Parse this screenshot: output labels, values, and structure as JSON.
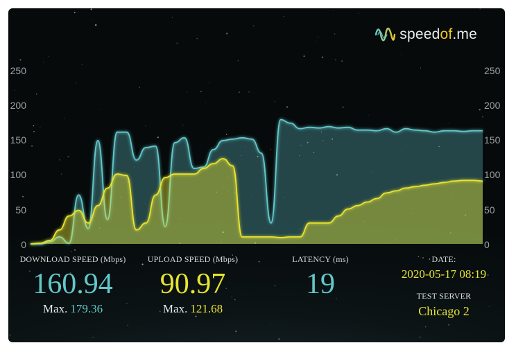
{
  "logo": {
    "text_pre": "speed",
    "text_of": "of",
    "text_post": ".me"
  },
  "colors": {
    "download": "#62c8cb",
    "upload": "#e8e432",
    "background": "#0b1315"
  },
  "axis": {
    "ticks": [
      "250",
      "200",
      "150",
      "100",
      "50",
      "0"
    ]
  },
  "download": {
    "label": "DOWNLOAD SPEED (Mbps)",
    "value": "160.94",
    "max_label": "Max.",
    "max_value": "179.36"
  },
  "upload": {
    "label": "UPLOAD SPEED (Mbps)",
    "value": "90.97",
    "max_label": "Max.",
    "max_value": "121.68"
  },
  "latency": {
    "label": "LATENCY (ms)",
    "value": "19"
  },
  "date": {
    "label": "DATE:",
    "value": "2020-05-17 08:19"
  },
  "server": {
    "label": "TEST SERVER",
    "value": "Chicago 2"
  },
  "chart_data": {
    "type": "area",
    "ylim": [
      0,
      250
    ],
    "grid": false,
    "series": [
      {
        "values": [
          0,
          0,
          3,
          10,
          1,
          70,
          22,
          148,
          35,
          160,
          160,
          120,
          138,
          140,
          25,
          145,
          152,
          108,
          110,
          135,
          148,
          150,
          152,
          150,
          130,
          30,
          178,
          173,
          165,
          167,
          166,
          168,
          166,
          167,
          163,
          163,
          162,
          165,
          160,
          165,
          163,
          162,
          160,
          162,
          162,
          161,
          162,
          162
        ]
      },
      {
        "values": [
          0,
          1,
          5,
          20,
          40,
          48,
          30,
          55,
          80,
          100,
          98,
          20,
          30,
          70,
          95,
          100,
          100,
          100,
          108,
          115,
          122,
          112,
          10,
          10,
          10,
          10,
          9,
          10,
          10,
          30,
          30,
          30,
          40,
          50,
          55,
          60,
          65,
          73,
          76,
          80,
          82,
          84,
          86,
          88,
          90,
          91,
          91,
          90
        ]
      }
    ]
  }
}
